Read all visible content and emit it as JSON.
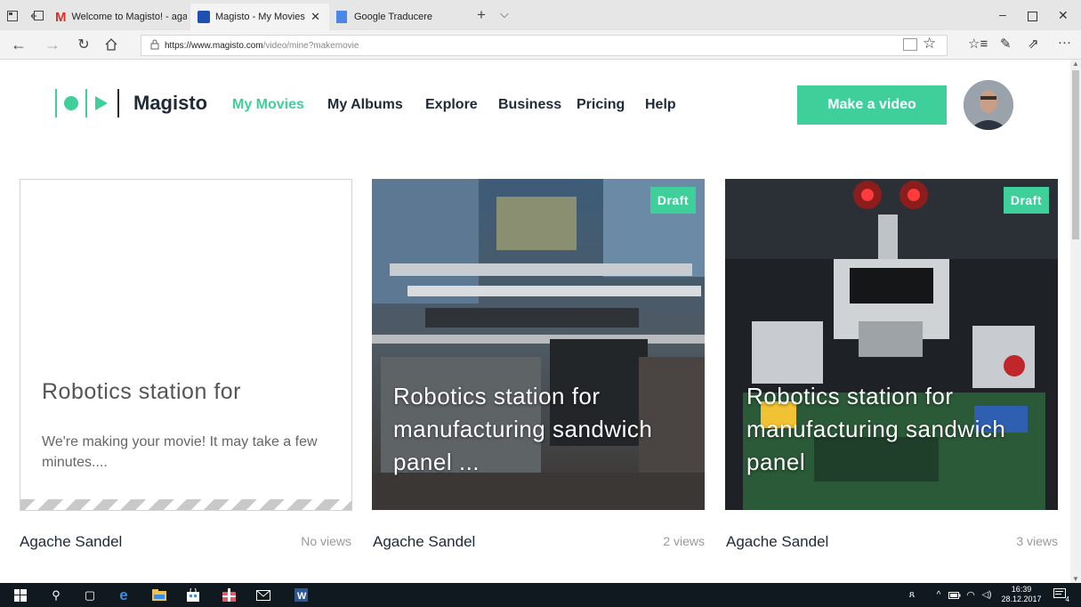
{
  "browser": {
    "tabs": [
      {
        "label": "Welcome to Magisto! - agac",
        "icon": "gmail-icon"
      },
      {
        "label": "Magisto - My Movies",
        "icon": "magisto-icon"
      },
      {
        "label": "Google Traducere",
        "icon": "google-translate-icon"
      }
    ],
    "url_domain": "https://www.magisto.com",
    "url_path": "/video/mine?makemovie"
  },
  "site": {
    "logo_text": "Magisto",
    "nav": {
      "my_movies": "My Movies",
      "my_albums": "My Albums",
      "explore": "Explore",
      "business": "Business",
      "pricing": "Pricing",
      "help": "Help"
    },
    "make_video_label": "Make a video",
    "colors": {
      "accent": "#3ecf9a",
      "text": "#1e2a38"
    }
  },
  "cards": [
    {
      "title": "Robotics station for",
      "message": "We're making your movie! It may take a few minutes....",
      "author": "Agache Sandel",
      "views": "No views"
    },
    {
      "title": "Robotics station for manufacturing sandwich panel ...",
      "badge": "Draft",
      "author": "Agache Sandel",
      "views": "2 views"
    },
    {
      "title": "Robotics station for manufacturing sandwich panel",
      "badge": "Draft",
      "author": "Agache Sandel",
      "views": "3 views"
    }
  ],
  "taskbar": {
    "time": "16:39",
    "date": "28.12.2017",
    "notification_count": "4"
  }
}
